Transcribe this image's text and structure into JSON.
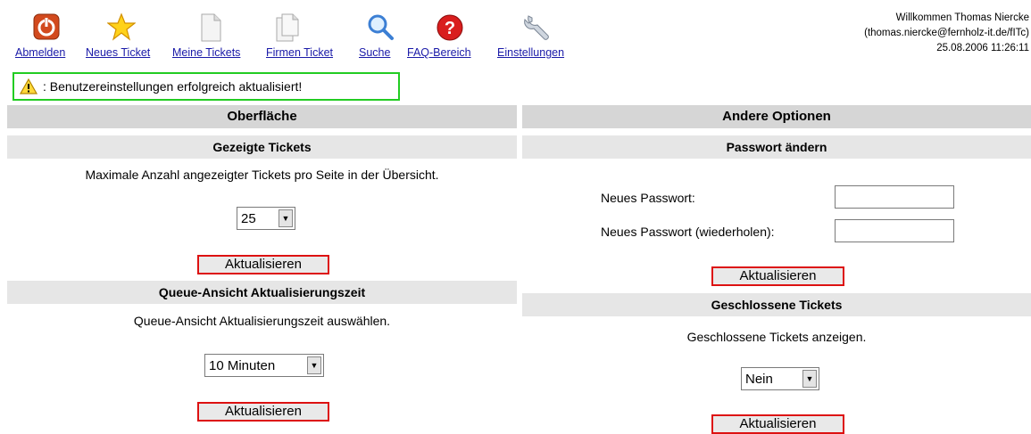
{
  "nav": {
    "items": [
      {
        "label": "Abmelden",
        "icon": "logout-icon"
      },
      {
        "label": "Neues Ticket",
        "icon": "star-icon"
      },
      {
        "label": "Meine Tickets",
        "icon": "document-icon"
      },
      {
        "label": "Firmen Ticket",
        "icon": "documents-icon"
      },
      {
        "label": "Suche",
        "icon": "search-icon"
      },
      {
        "label": "FAQ-Bereich",
        "icon": "help-icon"
      },
      {
        "label": "Einstellungen",
        "icon": "wrench-icon"
      }
    ]
  },
  "user": {
    "welcome": "Willkommen Thomas Niercke",
    "email": "(thomas.niercke@fernholz-it.de/fITc)",
    "datetime": "25.08.2006 11:26:11"
  },
  "status": {
    "message": ": Benutzereinstellungen erfolgreich aktualisiert!"
  },
  "left": {
    "header": "Oberfläche",
    "shown_tickets": {
      "title": "Gezeigte Tickets",
      "description": "Maximale Anzahl angezeigter Tickets pro Seite in der Übersicht.",
      "value": "25",
      "button": "Aktualisieren"
    },
    "refresh": {
      "title": "Queue-Ansicht Aktualisierungszeit",
      "description": "Queue-Ansicht Aktualisierungszeit auswählen.",
      "value": "10 Minuten",
      "button": "Aktualisieren"
    }
  },
  "right": {
    "header": "Andere Optionen",
    "password": {
      "title": "Passwort ändern",
      "new_label": "Neues Passwort:",
      "repeat_label": "Neues Passwort (wiederholen):",
      "button": "Aktualisieren"
    },
    "closed": {
      "title": "Geschlossene Tickets",
      "description": "Geschlossene Tickets anzeigen.",
      "value": "Nein",
      "button": "Aktualisieren"
    }
  },
  "colors": {
    "link": "#1a1aa8",
    "status_border": "#22cc22",
    "button_border": "#dd1111",
    "header_bg": "#d6d6d6",
    "subheader_bg": "#e6e6e6"
  }
}
